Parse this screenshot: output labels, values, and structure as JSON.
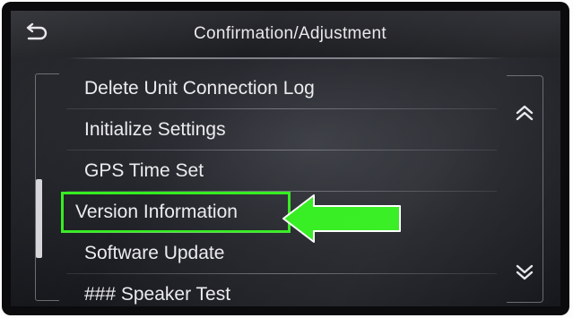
{
  "header": {
    "title": "Confirmation/Adjustment",
    "back_icon": "back-arrow-icon"
  },
  "menu": {
    "items": [
      {
        "label": "Delete Unit Connection Log"
      },
      {
        "label": "Initialize Settings"
      },
      {
        "label": "GPS Time Set"
      },
      {
        "label": "Version Information",
        "highlighted": true
      },
      {
        "label": "Software Update"
      },
      {
        "label": "### Speaker Test"
      }
    ]
  },
  "scroll": {
    "up_icon": "double-chevron-up-icon",
    "down_icon": "double-chevron-down-icon"
  },
  "annotation": {
    "highlight_color": "#33ee1e",
    "arrow_color": "#33ee1e",
    "arrow_icon": "left-arrow-icon"
  },
  "colors": {
    "screen_bg": "#24262c",
    "text": "#ececef"
  }
}
